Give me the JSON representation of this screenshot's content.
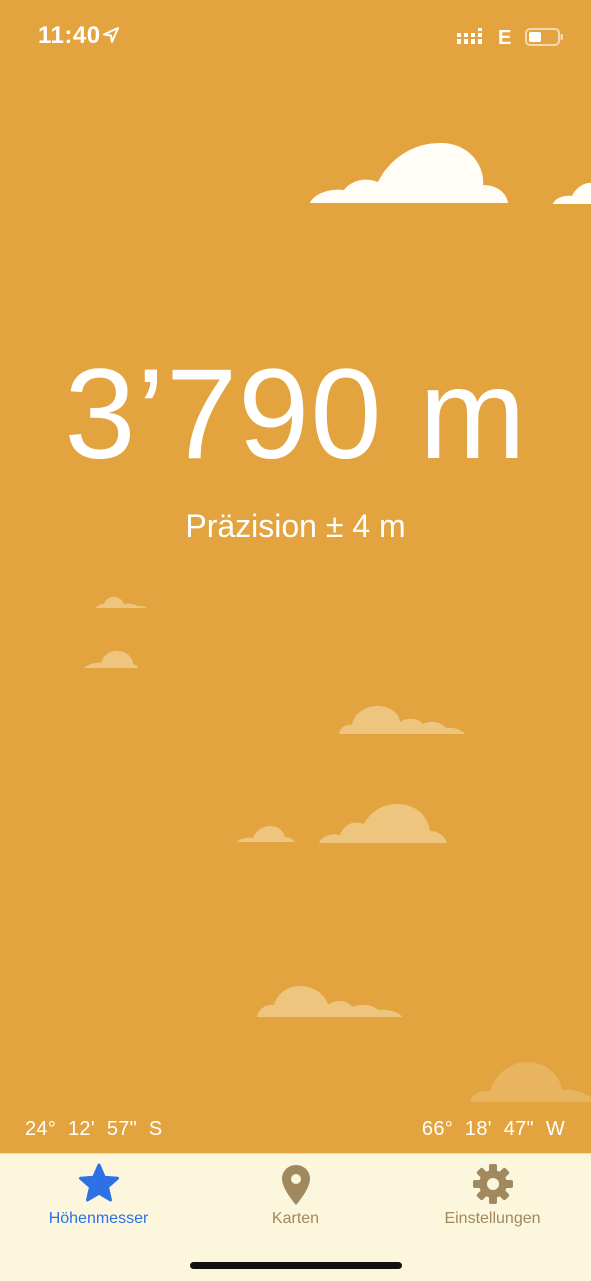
{
  "status_bar": {
    "time": "11:40",
    "network": "E",
    "location_icon": "location-arrow-icon",
    "signal_icon": "signal-bars-icon",
    "battery_icon": "battery-icon"
  },
  "altimeter": {
    "altitude": "3’790 m",
    "precision": "Präzision ± 4 m"
  },
  "coordinates": {
    "latitude": "24° 12' 57\" S",
    "longitude": "66° 18' 47\" W"
  },
  "tab_bar": {
    "tabs": [
      {
        "label": "Höhenmesser",
        "icon": "star-icon",
        "active": true
      },
      {
        "label": "Karten",
        "icon": "map-pin-icon",
        "active": false
      },
      {
        "label": "Einstellungen",
        "icon": "gear-icon",
        "active": false
      }
    ]
  },
  "colors": {
    "background": "#E3A440",
    "tab_bar_background": "#FCF7DC",
    "active_tab": "#2D71E5",
    "inactive_tab": "#A0895E",
    "cloud_white": "#FFFDF5",
    "cloud_faded": "#EDC57F"
  }
}
